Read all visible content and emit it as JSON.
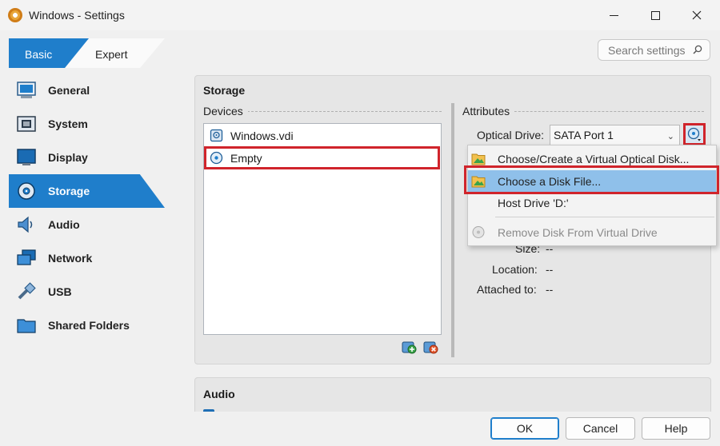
{
  "window": {
    "title": "Windows - Settings"
  },
  "mode_tabs": {
    "basic": "Basic",
    "expert": "Expert"
  },
  "search": {
    "placeholder": "Search settings"
  },
  "sidebar": {
    "items": [
      {
        "label": "General",
        "icon": "general-icon"
      },
      {
        "label": "System",
        "icon": "system-icon"
      },
      {
        "label": "Display",
        "icon": "display-icon"
      },
      {
        "label": "Storage",
        "icon": "storage-icon",
        "active": true
      },
      {
        "label": "Audio",
        "icon": "audio-icon"
      },
      {
        "label": "Network",
        "icon": "network-icon"
      },
      {
        "label": "USB",
        "icon": "usb-icon"
      },
      {
        "label": "Shared Folders",
        "icon": "shared-folders-icon"
      }
    ]
  },
  "storage": {
    "title": "Storage",
    "devices_label": "Devices",
    "devices": [
      {
        "label": "Windows.vdi",
        "icon": "hard-disk-icon"
      },
      {
        "label": "Empty",
        "icon": "optical-disk-icon"
      }
    ],
    "attributes_label": "Attributes",
    "optical_drive_label": "Optical Drive:",
    "optical_drive_value": "SATA Port 1",
    "info": {
      "size_label": "Size:",
      "size_value": "--",
      "location_label": "Location:",
      "location_value": "--",
      "attached_label": "Attached to:",
      "attached_value": "--"
    }
  },
  "menu": {
    "items": [
      {
        "label": "Choose/Create a Virtual Optical Disk...",
        "icon": "folder-disk-icon"
      },
      {
        "label": "Choose a Disk File...",
        "icon": "folder-disk-icon",
        "selected": true
      },
      {
        "label": "Host Drive 'D:'"
      },
      {
        "label": "Remove Disk From Virtual Drive",
        "icon": "remove-disk-icon",
        "disabled": true
      }
    ]
  },
  "audio": {
    "title": "Audio"
  },
  "buttons": {
    "ok": "OK",
    "cancel": "Cancel",
    "help": "Help"
  },
  "colors": {
    "accent": "#1f7ecb",
    "highlight_border": "#d0242b",
    "menu_selected": "#8fc0ea"
  }
}
